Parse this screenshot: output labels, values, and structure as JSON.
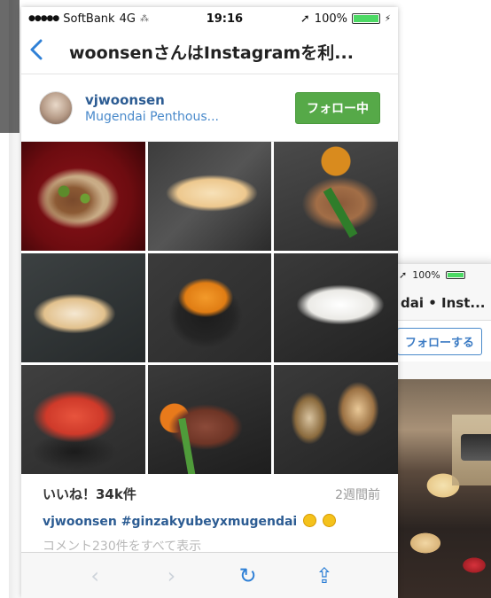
{
  "status_bar": {
    "signal": "●●●●●",
    "carrier": "SoftBank",
    "network": "4G",
    "time": "19:16",
    "location_glyph": "➚",
    "battery": "100%"
  },
  "nav": {
    "back_icon": "chevron-left-icon",
    "title": "woonsenさんはInstagramを利..."
  },
  "profile": {
    "username": "vjwoonsen",
    "location": "Mugendai Penthous...",
    "following_label": "フォロー中"
  },
  "post": {
    "likes": "いいね！34k件",
    "time_ago": "2週間前",
    "caption": "vjwoonsen #ginzakyubeyxmugendai",
    "comments": "コメント230件をすべて表示"
  },
  "toolbar": {
    "back": "‹",
    "forward": "›",
    "reload": "↻",
    "share": "⇪"
  },
  "back_window": {
    "battery": "100%",
    "title": "dai • Inst...",
    "follow_label": "フォローする"
  },
  "colors": {
    "link_blue": "#2f80d6",
    "username_blue": "#2c5c93",
    "follow_green": "#56a948"
  }
}
